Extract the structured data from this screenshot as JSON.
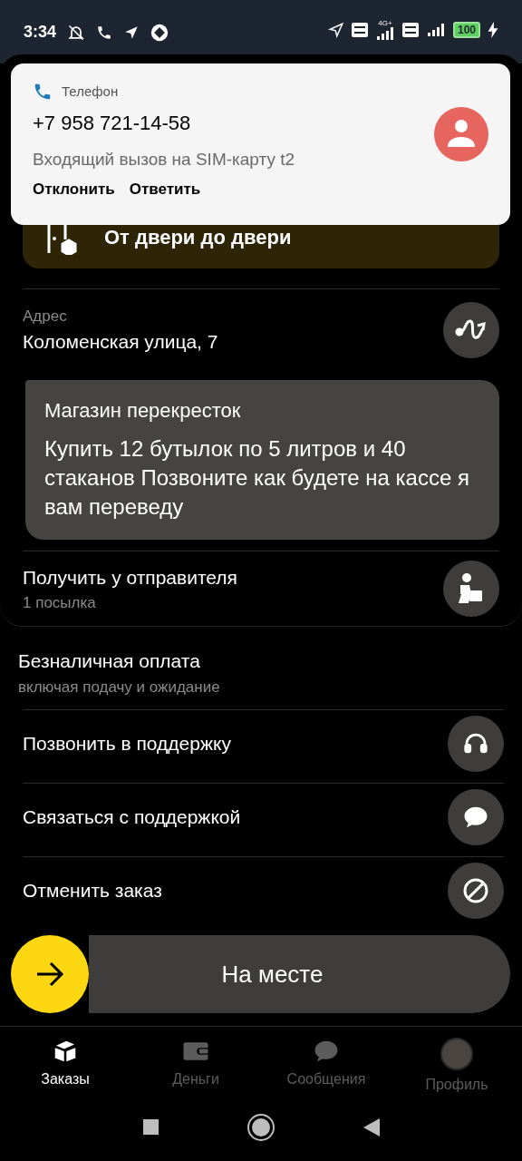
{
  "status_bar": {
    "time": "3:34",
    "battery": "100",
    "network": "4G+"
  },
  "notification": {
    "app": "Телефон",
    "caller": "+7 958 721-14-58",
    "text": "Входящий вызов на SIM-карту t2",
    "actions": [
      "Отклонить",
      "Ответить"
    ]
  },
  "order": {
    "tariff": "От двери до двери",
    "address_label": "Адрес",
    "address": "Коломенская улица, 7",
    "comment_title": "Магазин перекресток",
    "comment": "Купить 12 бутылок по 5 литров и 40 стаканов Позвоните как будете на кассе я вам переведу",
    "pickup_title": "Получить у отправителя",
    "pickup_subtitle": "1 посылка"
  },
  "payment": {
    "title": "Безналичная оплата",
    "subtitle": "включая подачу и ожидание"
  },
  "actions": [
    {
      "label": "Позвонить в поддержку",
      "kind": "call"
    },
    {
      "label": "Связаться с поддержкой",
      "kind": "chat"
    },
    {
      "label": "Отменить заказ",
      "kind": "cancel"
    }
  ],
  "slide_button": {
    "label": "На месте",
    "level": 0
  },
  "tabs": [
    {
      "label": "Заказы",
      "kind": "orders",
      "selected": true
    },
    {
      "label": "Деньги",
      "kind": "money",
      "selected": false
    },
    {
      "label": "Сообщения",
      "kind": "messages",
      "selected": false
    },
    {
      "label": "Профиль",
      "kind": "profile",
      "selected": false
    }
  ]
}
